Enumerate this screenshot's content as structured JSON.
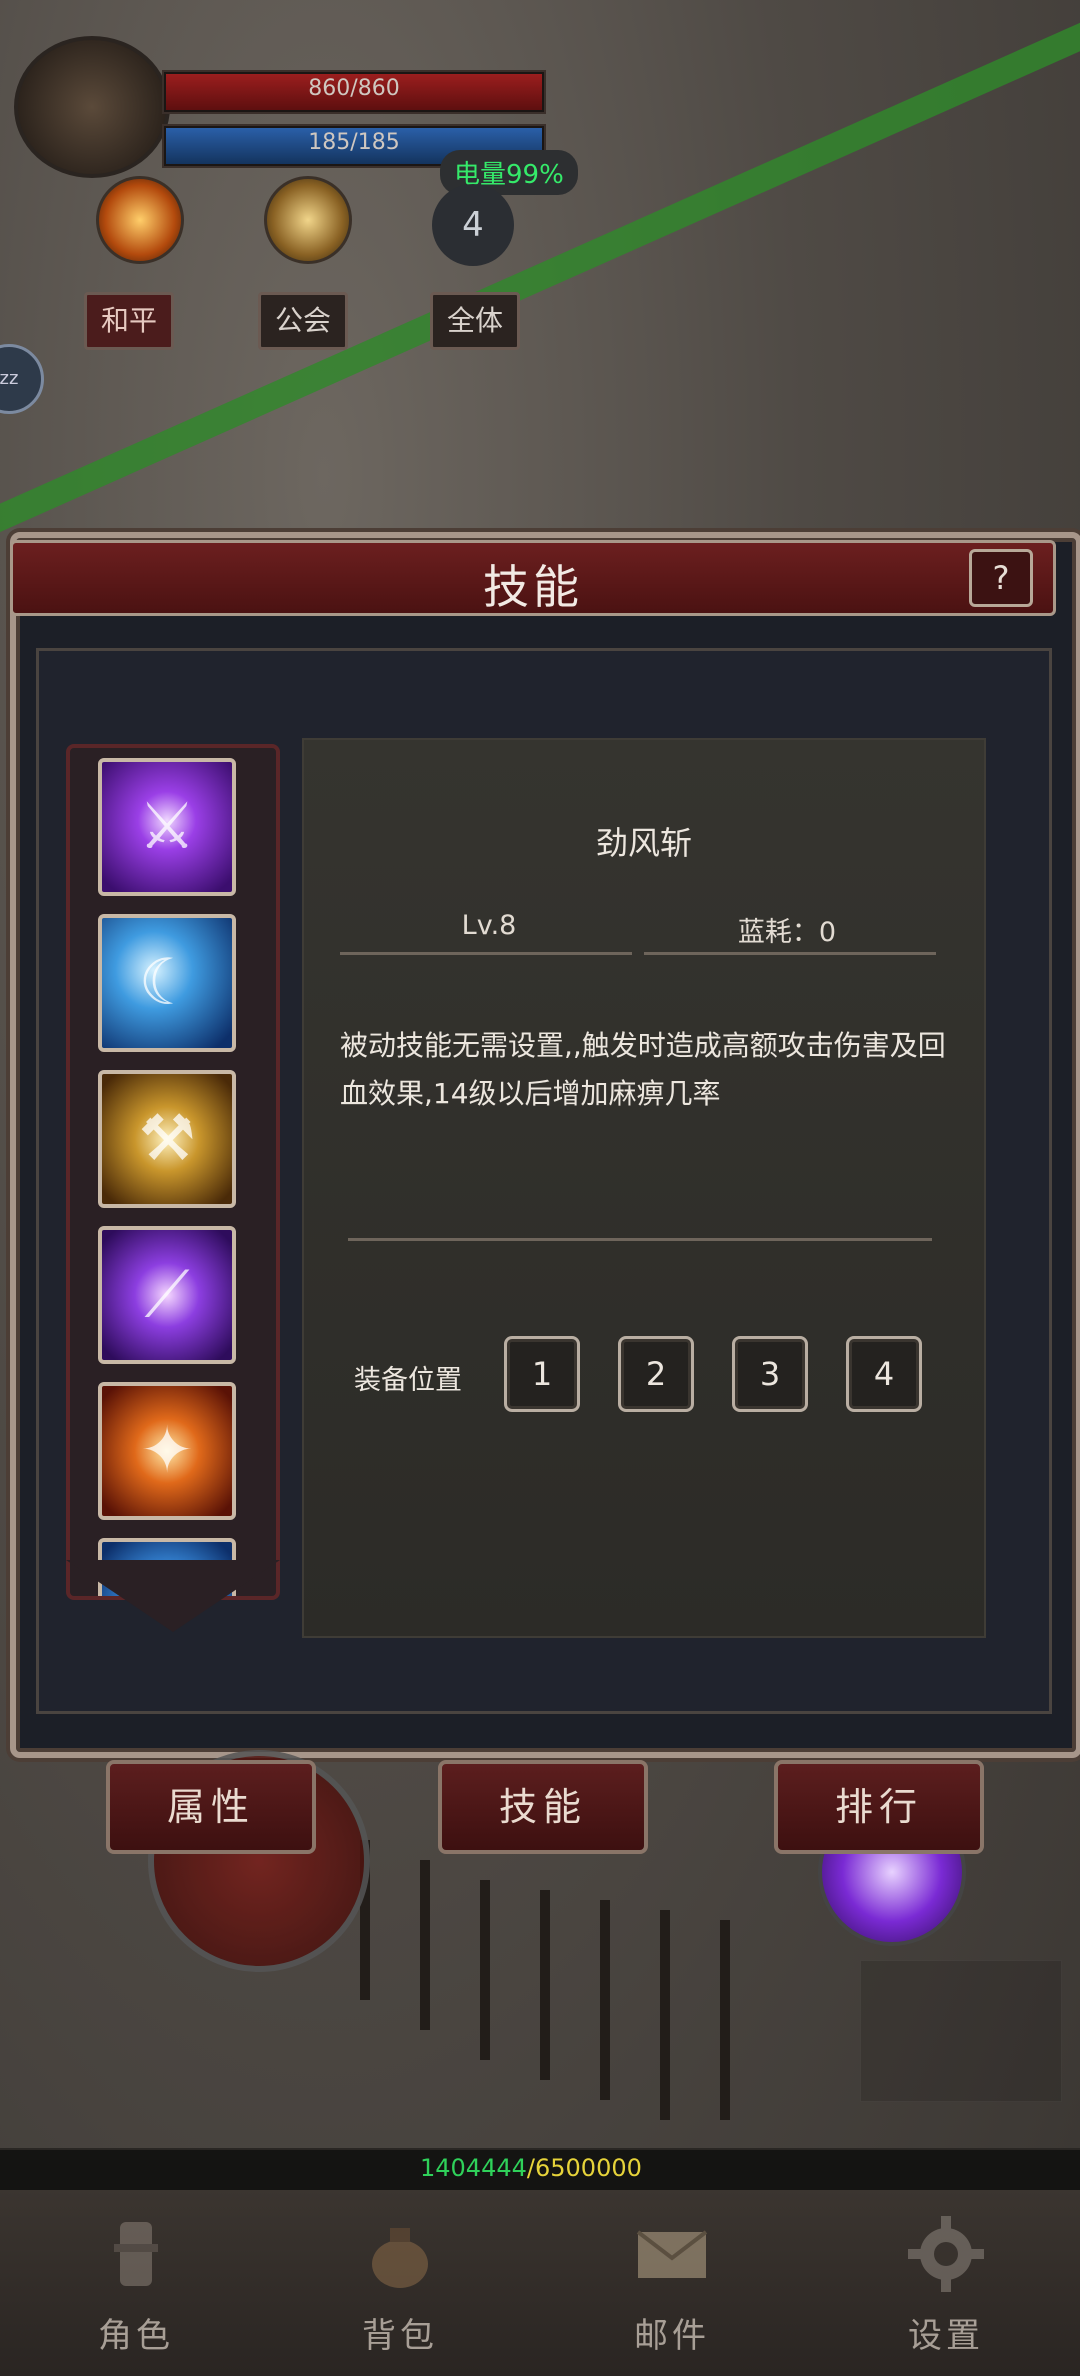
{
  "hud": {
    "hp": "860/860",
    "mp": "185/185",
    "battery": "电量99%",
    "level": "4",
    "chat_tabs": [
      "和平",
      "公会",
      "全体"
    ]
  },
  "panel": {
    "title": "技能",
    "help": "?",
    "skill": {
      "name": "劲风斩",
      "level": "Lv.8",
      "mana_cost": "蓝耗：0",
      "description": "被动技能无需设置,,触发时造成高额攻击伤害及回血效果,14级以后增加麻痹几率"
    },
    "equip": {
      "label": "装备位置",
      "slots": [
        "1",
        "2",
        "3",
        "4"
      ]
    },
    "skill_icons": [
      "purple-sword-skill-icon",
      "blue-crescent-skill-icon",
      "golden-axe-skill-icon",
      "purple-blade-skill-icon",
      "fire-slash-skill-icon",
      "blue-skill-icon"
    ]
  },
  "tabs": [
    "属性",
    "技能",
    "排行"
  ],
  "exp": {
    "current": "1404444",
    "max": "6500000"
  },
  "nav": [
    {
      "label": "角色",
      "icon": "character-icon"
    },
    {
      "label": "背包",
      "icon": "bag-icon"
    },
    {
      "label": "邮件",
      "icon": "mail-icon"
    },
    {
      "label": "设置",
      "icon": "gear-icon"
    }
  ]
}
